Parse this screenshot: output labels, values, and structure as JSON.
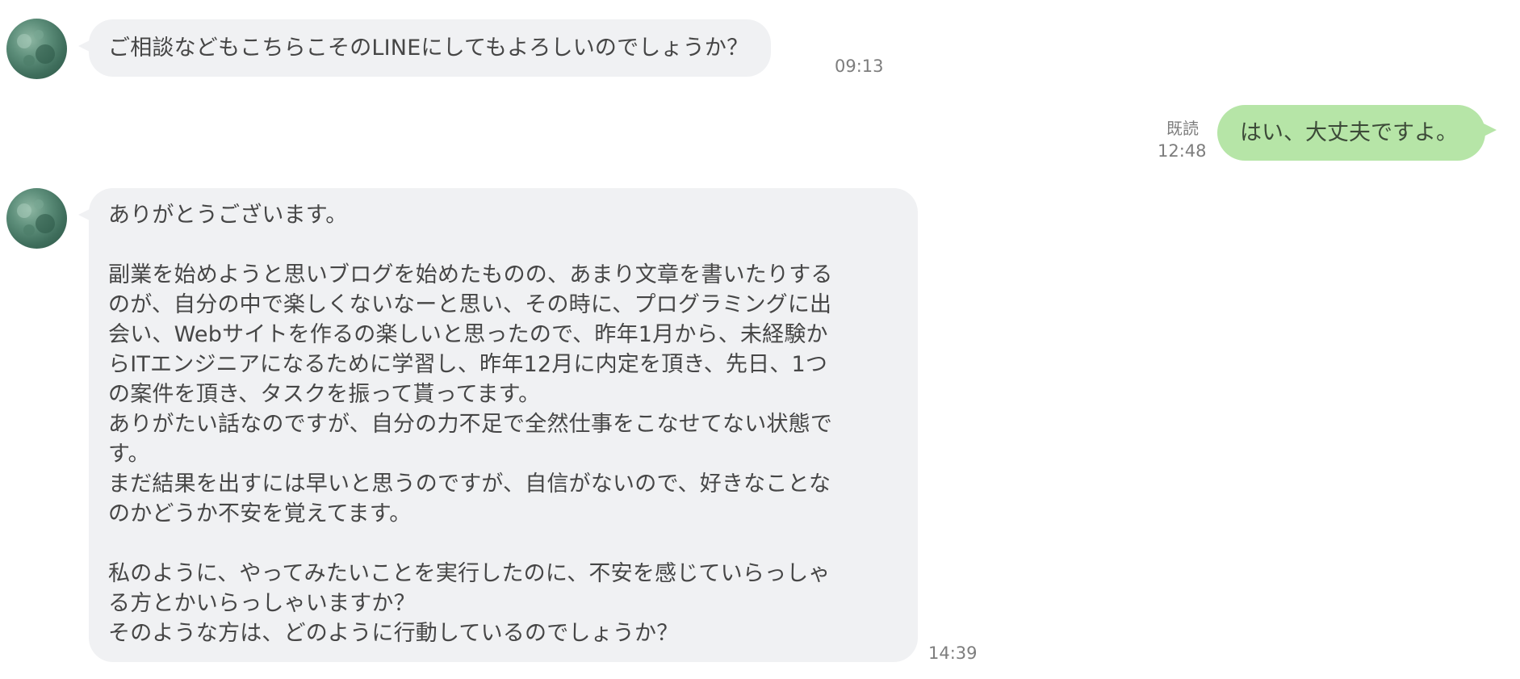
{
  "messages": [
    {
      "text": "ご相談などもこちらこそのLINEにしてもよろしいのでしょうか？",
      "time": "09:13"
    },
    {
      "text": "はい、大丈夫ですよ。",
      "read": "既読",
      "time": "12:48"
    },
    {
      "lines": [
        "ありがとうございます。",
        "",
        "副業を始めようと思いブログを始めたものの、あまり文章を書いたりする",
        "のが、自分の中で楽しくないなーと思い、その時に、プログラミングに出",
        "会い、Webサイトを作るの楽しいと思ったので、昨年1月から、未経験か",
        "らITエンジニアになるために学習し、昨年12月に内定を頂き、先日、1つ",
        "の案件を頂き、タスクを振って貰ってます。",
        "ありがたい話なのですが、自分の力不足で全然仕事をこなせてない状態で",
        "す。",
        "まだ結果を出すには早いと思うのですが、自信がないので、好きなことな",
        "のかどうか不安を覚えてます。",
        "",
        "私のように、やってみたいことを実行したのに、不安を感じていらっしゃ",
        "る方とかいらっしゃいますか？",
        "そのような方は、どのように行動しているのでしょうか？"
      ],
      "time": "14:39"
    }
  ],
  "colors": {
    "incoming_bubble": "#f0f1f3",
    "outgoing_bubble": "#b6e5a7",
    "timestamp": "#7d7d7d"
  }
}
